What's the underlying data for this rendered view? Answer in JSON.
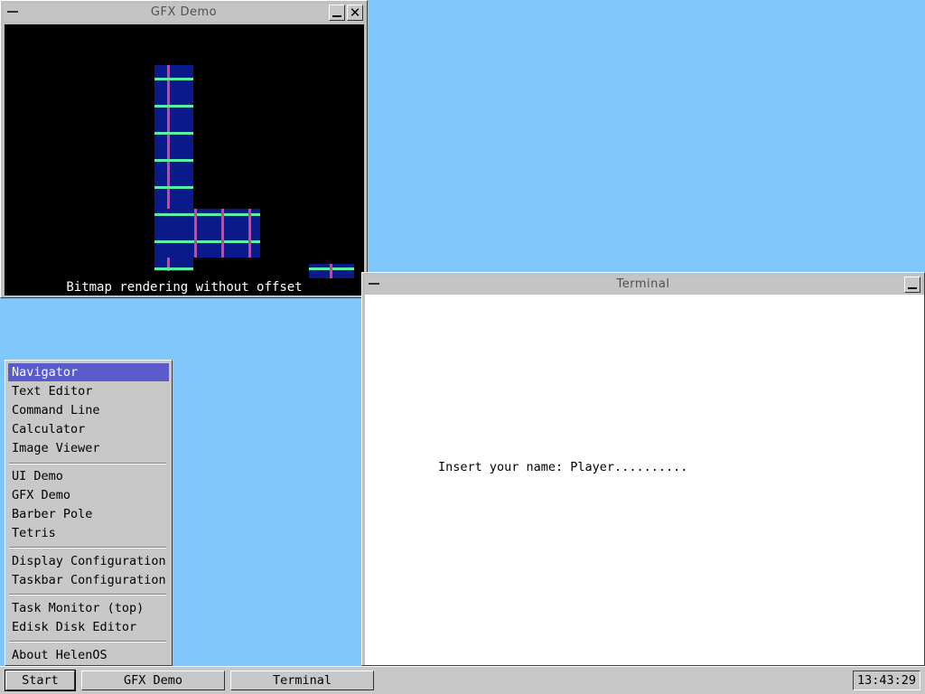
{
  "gfx_window": {
    "title": "GFX Demo",
    "caption": "Bitmap rendering without offset",
    "minimize_icon": "minimize-icon",
    "close_glyph": "✕"
  },
  "terminal_window": {
    "title": "Terminal",
    "prompt_line": "Insert your name: Player.........."
  },
  "start_menu": {
    "items": [
      {
        "label": "Navigator"
      },
      {
        "label": "Text Editor"
      },
      {
        "label": "Command Line"
      },
      {
        "label": "Calculator"
      },
      {
        "label": "Image Viewer"
      },
      {
        "label": "UI Demo"
      },
      {
        "label": "GFX Demo"
      },
      {
        "label": "Barber Pole"
      },
      {
        "label": "Tetris"
      },
      {
        "label": "Display Configuration"
      },
      {
        "label": "Taskbar Configuration"
      },
      {
        "label": "Task Monitor (top)"
      },
      {
        "label": "Edisk Disk Editor"
      },
      {
        "label": "About HelenOS"
      }
    ],
    "selected": "Navigator"
  },
  "taskbar": {
    "start_label": "Start",
    "tasks": [
      {
        "label": "GFX Demo"
      },
      {
        "label": "Terminal"
      }
    ],
    "clock": "13:43:29"
  },
  "colors": {
    "desktop": "#80c8fc",
    "menu_highlight": "#5a5ac8",
    "bitmap_tile": "#0a1a8a",
    "bitmap_h_line": "#58f0a8",
    "bitmap_v_line": "#e0408a"
  }
}
